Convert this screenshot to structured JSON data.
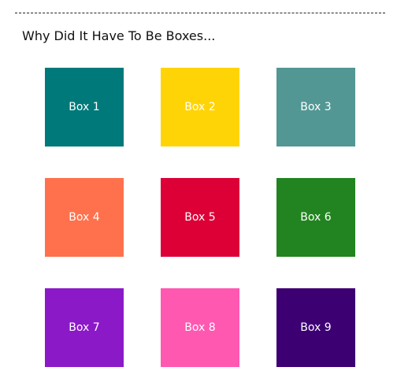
{
  "heading": "Why Did It Have To Be Boxes...",
  "boxes": [
    {
      "label": "Box 1",
      "color": "#00797A"
    },
    {
      "label": "Box 2",
      "color": "#FFD407"
    },
    {
      "label": "Box 3",
      "color": "#529794"
    },
    {
      "label": "Box 4",
      "color": "#FF714C"
    },
    {
      "label": "Box 5",
      "color": "#DC0037"
    },
    {
      "label": "Box 6",
      "color": "#228420"
    },
    {
      "label": "Box 7",
      "color": "#8C19C8"
    },
    {
      "label": "Box 8",
      "color": "#FF58B1"
    },
    {
      "label": "Box 9",
      "color": "#3C0073"
    }
  ]
}
